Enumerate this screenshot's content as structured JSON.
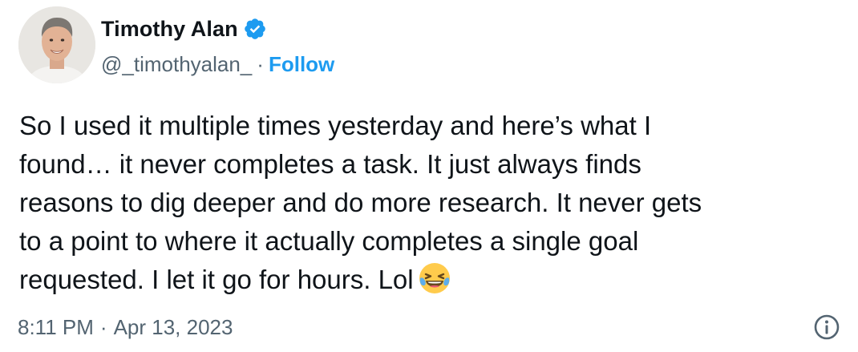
{
  "tweet": {
    "author": {
      "name": "Timothy Alan",
      "handle": "@_timothyalan_",
      "verified": true,
      "avatar": "profile-photo"
    },
    "separator": "·",
    "follow_label": "Follow",
    "text": "So I used it multiple times yesterday and here’s what I\nfound… it never completes a task. It just always finds\nreasons to dig deeper and do more research. It never gets\nto a point to where it actually completes a single goal\nrequested. I let it go for hours. Lol",
    "emoji": "face-with-tears-of-joy",
    "time": "8:11 PM",
    "date_separator": "·",
    "date": "Apr 13, 2023",
    "icons": {
      "verified": "verified-badge-icon",
      "info": "info-icon"
    },
    "colors": {
      "link": "#1d9bf0",
      "secondary_text": "#536471",
      "primary_text": "#0f1419"
    }
  }
}
